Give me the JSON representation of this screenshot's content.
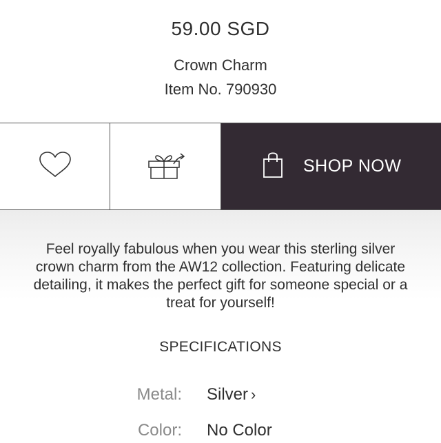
{
  "product": {
    "price": "59.00 SGD",
    "name": "Crown Charm",
    "item_no": "Item No. 790930"
  },
  "actions": {
    "wishlist_icon": "heart-icon",
    "gift_icon": "gift-send-icon",
    "shop_icon": "shopping-bag-icon",
    "shop_label": "SHOP NOW",
    "shop_bg_color": "#332a33"
  },
  "description": {
    "text": "Feel royally fabulous when you wear this sterling silver crown charm from the AW12 collection. Featuring delicate detailing, it makes the perfect gift for someone special or a treat for yourself!"
  },
  "specifications": {
    "heading": "SPECIFICATIONS",
    "metal_label": "Metal:",
    "metal_value": "Silver",
    "metal_chevron": "›",
    "color_label": "Color:",
    "color_value": "No Color"
  }
}
